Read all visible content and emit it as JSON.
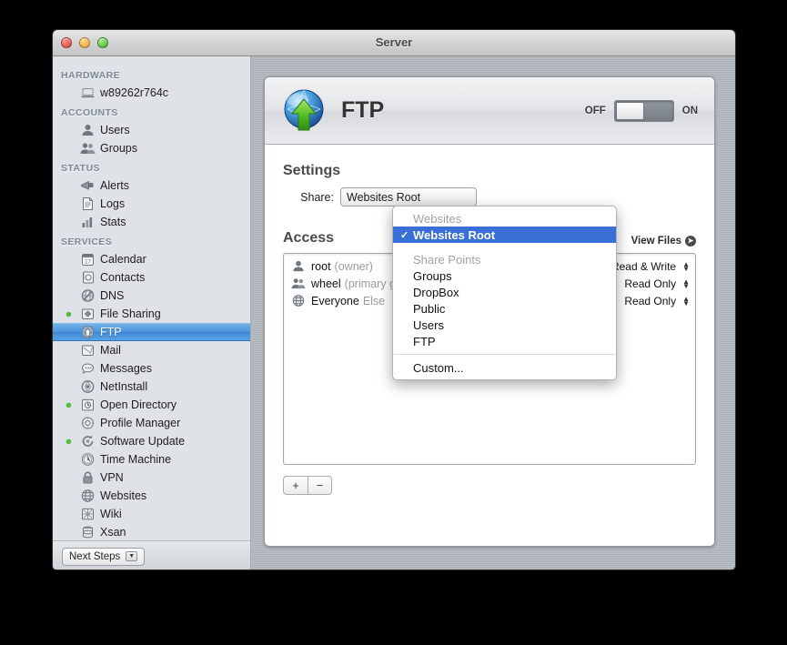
{
  "window": {
    "title": "Server"
  },
  "sidebar": {
    "groups": [
      {
        "title": "HARDWARE",
        "items": [
          {
            "label": "w89262r764c",
            "icon": "laptop-icon",
            "running": false,
            "selected": false
          }
        ]
      },
      {
        "title": "ACCOUNTS",
        "items": [
          {
            "label": "Users",
            "icon": "user-icon",
            "running": false,
            "selected": false
          },
          {
            "label": "Groups",
            "icon": "users-icon",
            "running": false,
            "selected": false
          }
        ]
      },
      {
        "title": "STATUS",
        "items": [
          {
            "label": "Alerts",
            "icon": "megaphone-icon",
            "running": false,
            "selected": false
          },
          {
            "label": "Logs",
            "icon": "document-icon",
            "running": false,
            "selected": false
          },
          {
            "label": "Stats",
            "icon": "barchart-icon",
            "running": false,
            "selected": false
          }
        ]
      },
      {
        "title": "SERVICES",
        "items": [
          {
            "label": "Calendar",
            "icon": "calendar-icon",
            "running": false,
            "selected": false
          },
          {
            "label": "Contacts",
            "icon": "contacts-icon",
            "running": false,
            "selected": false
          },
          {
            "label": "DNS",
            "icon": "dns-icon",
            "running": false,
            "selected": false
          },
          {
            "label": "File Sharing",
            "icon": "filesharing-icon",
            "running": true,
            "selected": false
          },
          {
            "label": "FTP",
            "icon": "ftp-icon",
            "running": false,
            "selected": true
          },
          {
            "label": "Mail",
            "icon": "mail-icon",
            "running": false,
            "selected": false
          },
          {
            "label": "Messages",
            "icon": "messages-icon",
            "running": false,
            "selected": false
          },
          {
            "label": "NetInstall",
            "icon": "netinstall-icon",
            "running": false,
            "selected": false
          },
          {
            "label": "Open Directory",
            "icon": "opendirectory-icon",
            "running": true,
            "selected": false
          },
          {
            "label": "Profile Manager",
            "icon": "profilemanager-icon",
            "running": false,
            "selected": false
          },
          {
            "label": "Software Update",
            "icon": "softwareupdate-icon",
            "running": true,
            "selected": false
          },
          {
            "label": "Time Machine",
            "icon": "timemachine-icon",
            "running": false,
            "selected": false
          },
          {
            "label": "VPN",
            "icon": "lock-icon",
            "running": false,
            "selected": false
          },
          {
            "label": "Websites",
            "icon": "globe-icon",
            "running": false,
            "selected": false
          },
          {
            "label": "Wiki",
            "icon": "wiki-icon",
            "running": false,
            "selected": false
          },
          {
            "label": "Xsan",
            "icon": "xsan-icon",
            "running": false,
            "selected": false
          }
        ]
      }
    ],
    "next_steps": {
      "label": "Next Steps",
      "chevron": "chevron-down-icon"
    }
  },
  "service": {
    "name": "FTP",
    "icon": "ftp-icon",
    "toggle": {
      "off_label": "OFF",
      "on_label": "ON",
      "state": "off"
    }
  },
  "settings": {
    "title": "Settings",
    "share_label": "Share:",
    "share_value": "Websites Root"
  },
  "access": {
    "title": "Access",
    "view_files_label": "View Files",
    "view_files_icon": "circle-arrow-icon",
    "rows": [
      {
        "icon": "user-icon",
        "name": "root",
        "detail": "(owner)",
        "permission": "Read & Write"
      },
      {
        "icon": "users-icon",
        "name": "wheel",
        "detail": "(primary group)",
        "permission": "Read Only"
      },
      {
        "icon": "globe-icon",
        "name": "Everyone",
        "detail": "Else",
        "permission": "Read Only"
      }
    ],
    "add_label": "+",
    "remove_label": "−"
  },
  "share_menu": {
    "entries": [
      {
        "type": "header",
        "label": "Websites"
      },
      {
        "type": "selected",
        "label": "Websites Root",
        "check": "✓"
      },
      {
        "type": "space",
        "label": ""
      },
      {
        "type": "header",
        "label": "Share Points"
      },
      {
        "type": "item",
        "label": "Groups"
      },
      {
        "type": "item",
        "label": "DropBox"
      },
      {
        "type": "item",
        "label": "Public"
      },
      {
        "type": "item",
        "label": "Users"
      },
      {
        "type": "item",
        "label": "FTP"
      },
      {
        "type": "sep",
        "label": ""
      },
      {
        "type": "item",
        "label": "Custom..."
      }
    ]
  },
  "colors": {
    "selection_blue": "#3a6fd8",
    "sidebar_selection": "#4a92dc",
    "running_dot": "#4fbd3a"
  }
}
